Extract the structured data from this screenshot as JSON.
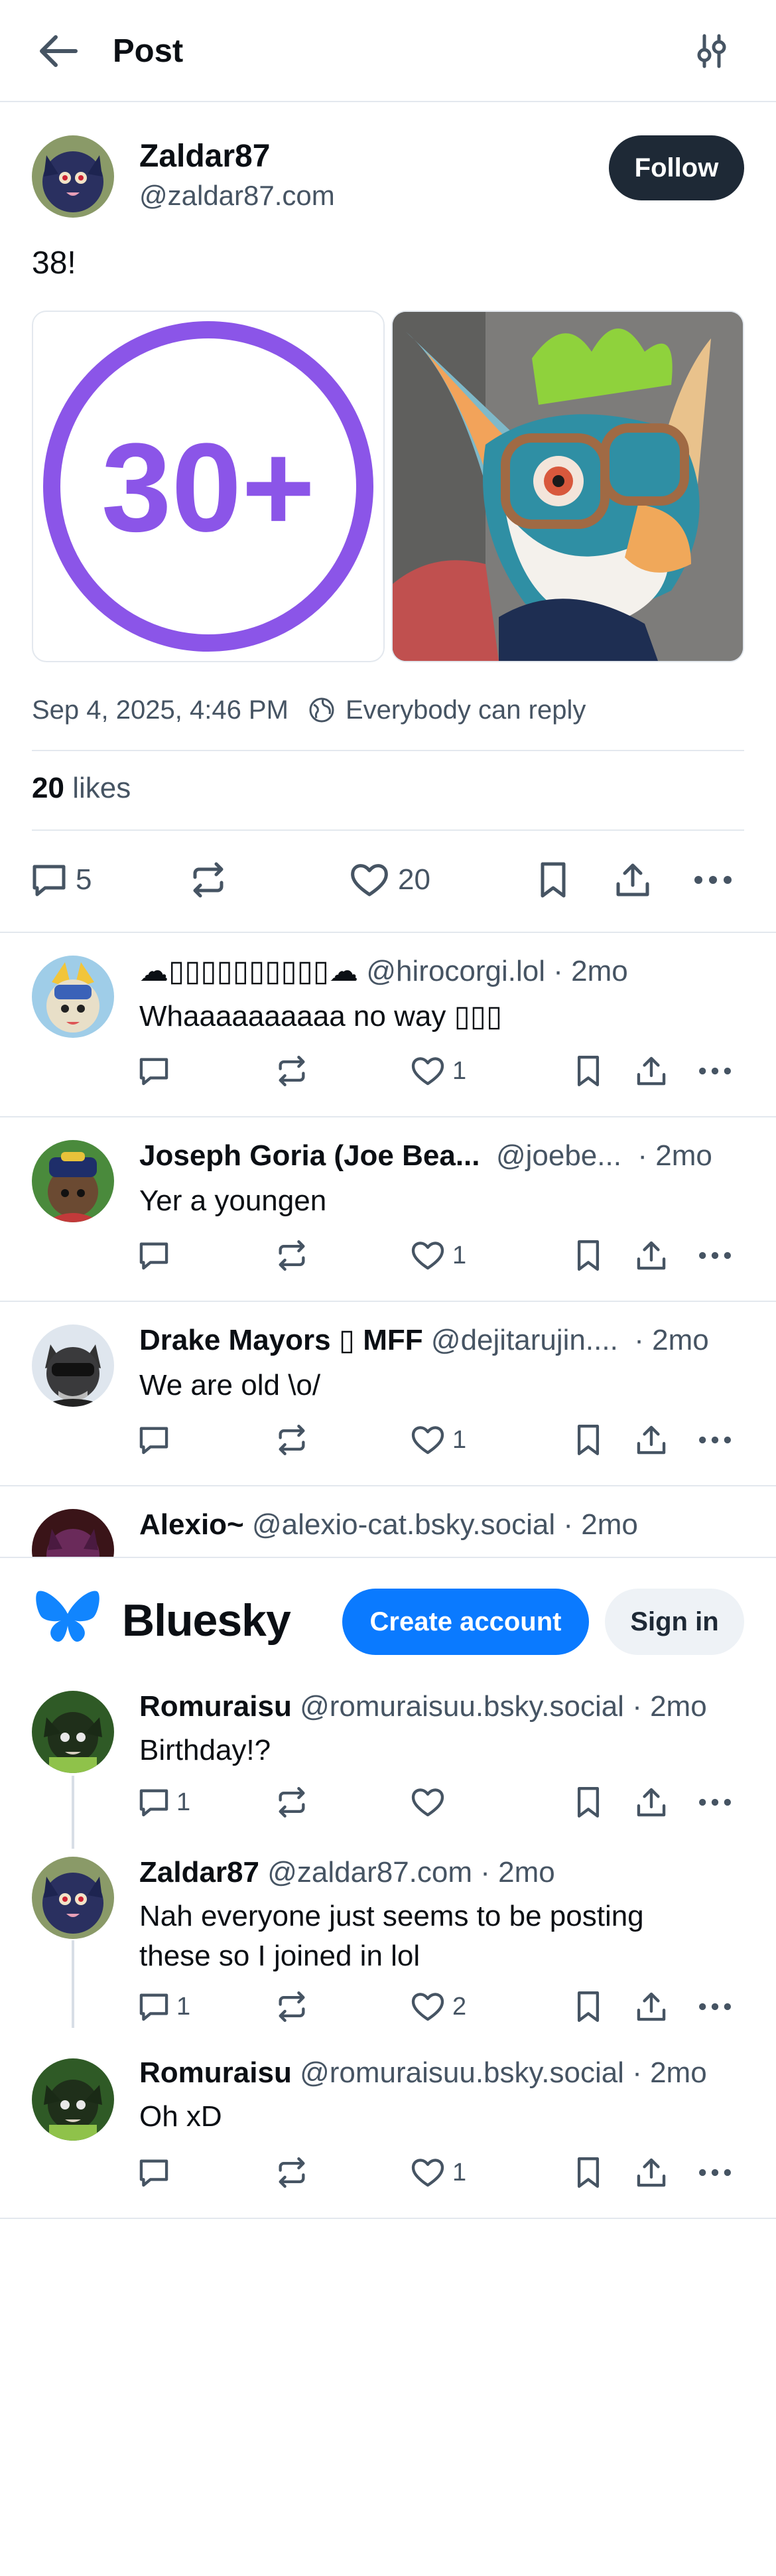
{
  "header": {
    "title": "Post"
  },
  "post": {
    "author_name": "Zaldar87",
    "author_handle": "@zaldar87.com",
    "follow_label": "Follow",
    "text": "38!",
    "image1_text": "30+",
    "timestamp": "Sep 4, 2025, 4:46 PM",
    "reply_setting": "Everybody can reply",
    "likes_count": "20",
    "likes_label": "likes",
    "reply_count": "5",
    "like_count": "20"
  },
  "replies": [
    {
      "name": "☁▯▯▯▯▯▯▯▯▯▯☁",
      "handle": "@hirocorgi.lol",
      "time": "· 2mo",
      "text": "Whaaaaaaaaaa no way ▯▯▯",
      "replies": "",
      "likes": "1"
    },
    {
      "name": "Joseph Goria (Joe Bea...",
      "handle": "@joebe...",
      "time": "· 2mo",
      "text": "Yer a youngen",
      "replies": "",
      "likes": "1"
    },
    {
      "name": "Drake Mayors ▯ MFF",
      "handle": "@dejitarujin....",
      "time": "· 2mo",
      "text": "We are old \\o/",
      "replies": "",
      "likes": "1"
    },
    {
      "name": "Alexio~",
      "handle": "@alexio-cat.bsky.social",
      "time": "· 2mo",
      "text": "",
      "replies": "",
      "likes": ""
    }
  ],
  "banner": {
    "wordmark": "Bluesky",
    "create_label": "Create account",
    "signin_label": "Sign in"
  },
  "thread": [
    {
      "name": "Romuraisu",
      "handle": "@romuraisuu.bsky.social",
      "time": "· 2mo",
      "text": "Birthday!?",
      "replies": "1",
      "likes": ""
    },
    {
      "name": "Zaldar87",
      "handle": "@zaldar87.com",
      "time": "· 2mo",
      "text": "Nah everyone just seems to be posting these so I joined in lol",
      "replies": "1",
      "likes": "2"
    },
    {
      "name": "Romuraisu",
      "handle": "@romuraisuu.bsky.social",
      "time": "· 2mo",
      "text": "Oh xD",
      "replies": "",
      "likes": "1"
    }
  ],
  "colors": {
    "accent": "#0a7aff",
    "follow_bg": "#1e2936",
    "muted": "#465463",
    "badge_purple": "#8b55e8"
  }
}
